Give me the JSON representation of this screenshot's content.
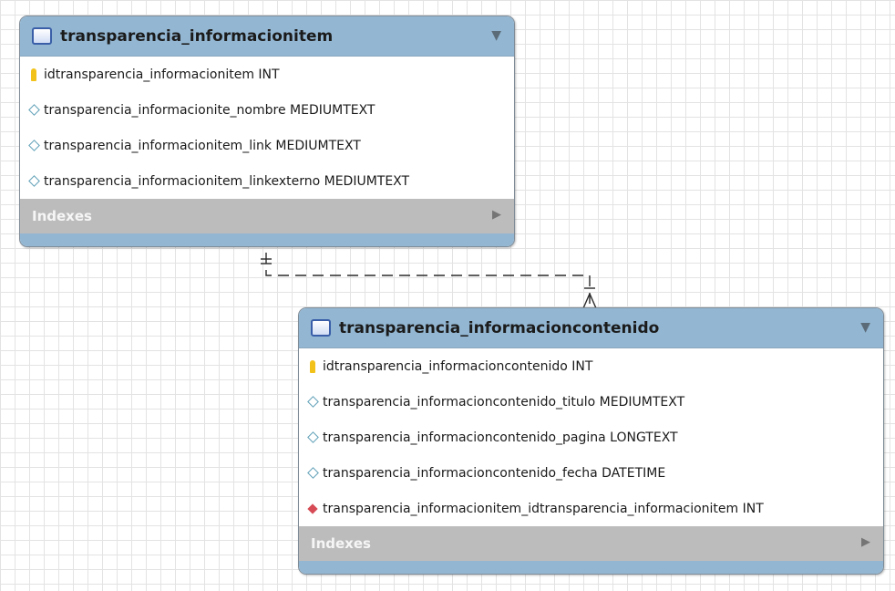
{
  "tables": [
    {
      "name": "transparencia_informacionitem",
      "columns": [
        {
          "text": "idtransparencia_informacionitem INT",
          "kind": "primary-key"
        },
        {
          "text": "transparencia_informacionite_nombre MEDIUMTEXT",
          "kind": "column"
        },
        {
          "text": "transparencia_informacionitem_link MEDIUMTEXT",
          "kind": "column"
        },
        {
          "text": "transparencia_informacionitem_linkexterno MEDIUMTEXT",
          "kind": "column"
        }
      ],
      "indexes_label": "Indexes"
    },
    {
      "name": "transparencia_informacioncontenido",
      "columns": [
        {
          "text": "idtransparencia_informacioncontenido INT",
          "kind": "primary-key"
        },
        {
          "text": "transparencia_informacioncontenido_titulo MEDIUMTEXT",
          "kind": "column"
        },
        {
          "text": "transparencia_informacioncontenido_pagina LONGTEXT",
          "kind": "column"
        },
        {
          "text": "transparencia_informacioncontenido_fecha DATETIME",
          "kind": "column"
        },
        {
          "text": "transparencia_informacionitem_idtransparencia_informacionitem INT",
          "kind": "foreign-key"
        }
      ],
      "indexes_label": "Indexes"
    }
  ],
  "relationship": {
    "from": "transparencia_informacionitem",
    "to": "transparencia_informacioncontenido",
    "cardinality": "one-to-many",
    "style": "dashed"
  },
  "colors": {
    "header": "#93b7d3",
    "indexes": "#bcbcbc",
    "primary_key": "#f2c21b",
    "foreign_key": "#d64b55",
    "column": "#5e9fb7",
    "grid": "#e3e3e3"
  }
}
